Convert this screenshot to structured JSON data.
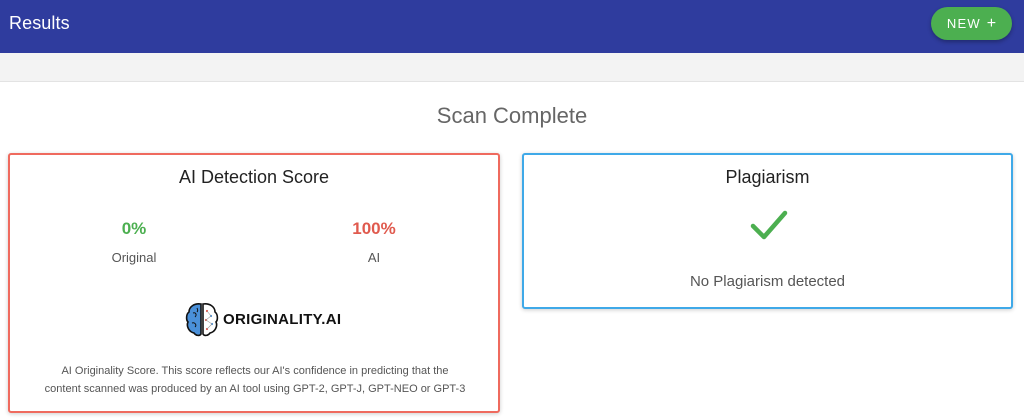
{
  "header": {
    "title": "Results",
    "new_button_label": "NEW",
    "new_button_icon": "plus-icon"
  },
  "main": {
    "scan_title": "Scan Complete"
  },
  "ai_card": {
    "title": "AI Detection Score",
    "original": {
      "value": "0%",
      "label": "Original"
    },
    "ai": {
      "value": "100%",
      "label": "AI"
    },
    "logo_text": "ORIGINALITY.AI",
    "description_line1": "AI Originality Score. This score reflects our AI's confidence in predicting that the",
    "description_line2": "content scanned was produced by an AI tool using GPT-2, GPT-J, GPT-NEO or GPT-3",
    "border_color": "#ef6a5e"
  },
  "plagiarism_card": {
    "title": "Plagiarism",
    "status_icon": "checkmark-icon",
    "message": "No Plagiarism detected",
    "border_color": "#3fa9e8"
  },
  "colors": {
    "header_bg": "#2f3c9e",
    "accent_green": "#4caf50",
    "original_green": "#4caf50",
    "ai_red": "#e05a4e"
  }
}
